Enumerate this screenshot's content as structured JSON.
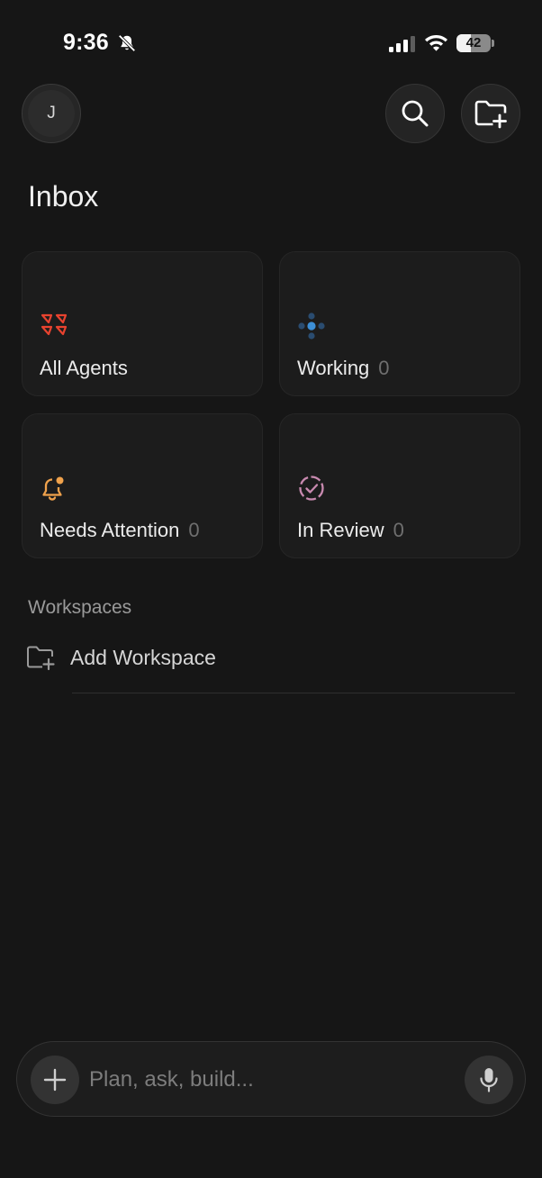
{
  "status_bar": {
    "time": "9:36",
    "battery_level": "42",
    "battery_fraction": 0.42
  },
  "header": {
    "avatar_initial": "J",
    "icons": {
      "search": "search-icon",
      "new_folder": "folder-plus-icon"
    }
  },
  "page": {
    "title": "Inbox"
  },
  "cards": [
    {
      "label": "All Agents",
      "count": "",
      "icon": "agents-icon",
      "color": "#e8432f"
    },
    {
      "label": "Working",
      "count": "0",
      "icon": "working-dots-icon",
      "color": "#3d8fd6"
    },
    {
      "label": "Needs Attention",
      "count": "0",
      "icon": "bell-alert-icon",
      "color": "#f0a24c"
    },
    {
      "label": "In Review",
      "count": "0",
      "icon": "review-check-icon",
      "color": "#c98ab0"
    }
  ],
  "workspaces": {
    "section_label": "Workspaces",
    "add_label": "Add Workspace"
  },
  "composer": {
    "placeholder": "Plan, ask, build...",
    "value": ""
  },
  "colors": {
    "background": "#161616",
    "card": "#1c1c1c",
    "muted_text": "#6f6f6f"
  }
}
